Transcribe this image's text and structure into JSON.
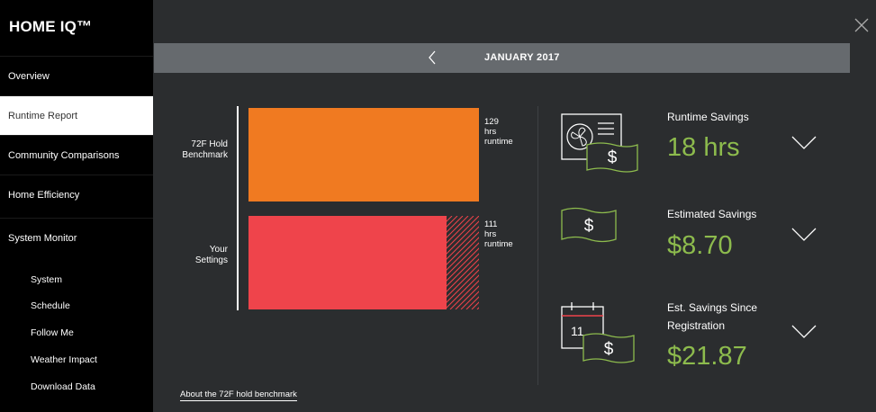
{
  "brand": "HOME IQ™",
  "nav": [
    {
      "label": "Overview"
    },
    {
      "label": "Runtime Report"
    },
    {
      "label": "Community Comparisons"
    },
    {
      "label": "Home Efficiency"
    },
    {
      "label": "System Monitor"
    }
  ],
  "sub_nav": [
    {
      "label": "System"
    },
    {
      "label": "Schedule"
    },
    {
      "label": "Follow Me"
    },
    {
      "label": "Weather Impact"
    },
    {
      "label": "Download Data"
    }
  ],
  "month": "JANUARY 2017",
  "chart_data": {
    "type": "bar",
    "orientation": "horizontal",
    "categories": [
      "72F Hold Benchmark",
      "Your Settings"
    ],
    "values": [
      129,
      111
    ],
    "units": "hrs runtime",
    "bar_labels": [
      {
        "value": "129",
        "line2": "hrs",
        "line3": "runtime"
      },
      {
        "value": "111",
        "line2": "hrs",
        "line3": "runtime"
      }
    ],
    "ylabels": [
      {
        "line1": "72F Hold",
        "line2": "Benchmark"
      },
      {
        "line1": "Your",
        "line2": "Settings"
      }
    ],
    "colors": [
      "#f07a21",
      "#ef444b"
    ],
    "savings_hatch_color": "#ef444b"
  },
  "savings": [
    {
      "title": "Runtime Savings",
      "value": "18 hrs",
      "icon": "fan-dollar-icon"
    },
    {
      "title": "Estimated Savings",
      "value": "$8.70",
      "icon": "dollar-bill-icon"
    },
    {
      "title_line1": "Est. Savings Since",
      "title_line2": "Registration",
      "value": "$21.87",
      "icon": "calendar-dollar-icon",
      "calendar_day": "11"
    }
  ],
  "about_link": "About the 72F hold benchmark",
  "colors": {
    "accent_green": "#8dbb4d",
    "sidebar": "#000000",
    "background": "#2b2d2f",
    "monthbar": "#666a6e"
  }
}
